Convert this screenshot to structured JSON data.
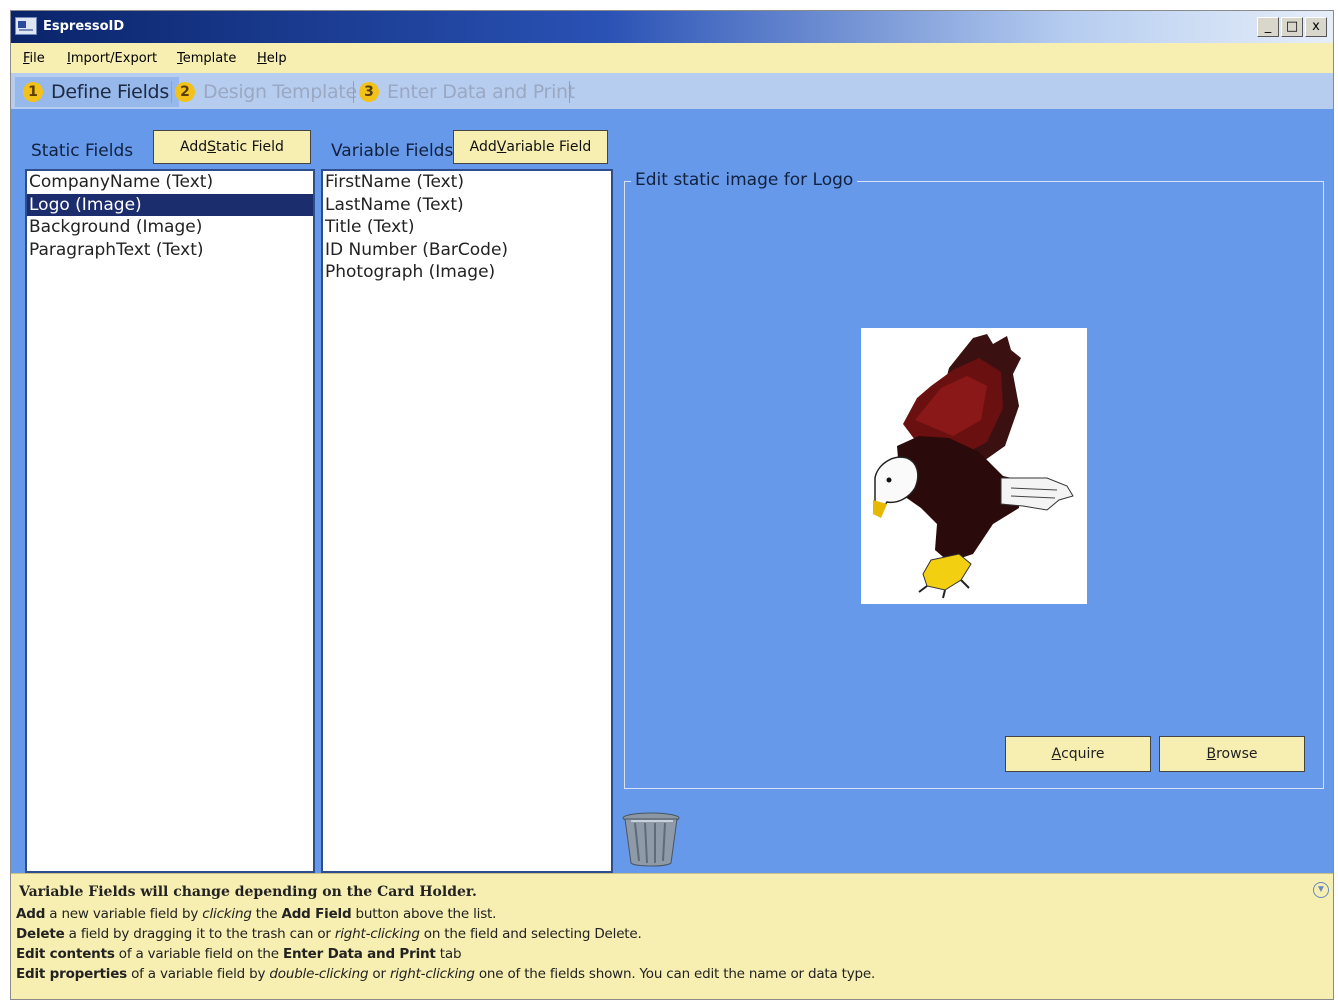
{
  "window": {
    "title": "EspressoID",
    "minimize": "_",
    "maximize": "□",
    "close": "x"
  },
  "menu": {
    "items": [
      {
        "accel": "F",
        "rest": "ile"
      },
      {
        "accel": "I",
        "rest": "mport/Export"
      },
      {
        "accel": "T",
        "rest": "emplate"
      },
      {
        "accel": "H",
        "rest": "elp"
      }
    ]
  },
  "tabs": [
    {
      "number": "1",
      "label": "Define Fields",
      "active": true
    },
    {
      "number": "2",
      "label": "Design Template",
      "active": false
    },
    {
      "number": "3",
      "label": "Enter Data and Print",
      "active": false
    }
  ],
  "static_fields": {
    "heading": "Static Fields",
    "add_button": {
      "pre": "Add ",
      "accel": "S",
      "post": "tatic Field"
    },
    "items": [
      "CompanyName (Text)",
      "Logo (Image)",
      "Background (Image)",
      "ParagraphText (Text)"
    ],
    "selected_index": 1
  },
  "variable_fields": {
    "heading": "Variable Fields",
    "add_button": {
      "pre": "Add ",
      "accel": "V",
      "post": "ariable Field"
    },
    "items": [
      "FirstName (Text)",
      "LastName (Text)",
      "Title (Text)",
      "ID Number (BarCode)",
      "Photograph (Image)"
    ]
  },
  "editor": {
    "legend": "Edit static image for Logo",
    "image_icon": "eagle-logo-image",
    "acquire": {
      "accel": "A",
      "rest": "cquire"
    },
    "browse": {
      "accel": "B",
      "rest": "rowse"
    }
  },
  "trash_icon": "trash-can-icon",
  "help": {
    "heading": "Variable Fields will change depending on the Card Holder.",
    "lines": {
      "add": {
        "b1": "Add",
        "t1": " a new variable field by ",
        "i1": "clicking",
        "t2": " the ",
        "b2": "Add Field",
        "t3": " button above the list."
      },
      "delete": {
        "b1": "Delete",
        "t1": " a field by dragging it to the trash can or ",
        "i1": "right-clicking",
        "t2": " on the field and selecting Delete."
      },
      "edit_contents": {
        "b1": "Edit contents",
        "t1": " of a variable field on the ",
        "b2": "Enter Data and Print",
        "t2": " tab"
      },
      "edit_properties": {
        "b1": "Edit properties",
        "t1": " of a variable field by ",
        "i1": "double-clicking",
        "t2": " or ",
        "i2": "right-clicking",
        "t3": " one of the fields shown.  You can edit the name or data type."
      }
    }
  },
  "colors": {
    "workspace": "#6699ea",
    "panel_yellow": "#f7efb1",
    "selection": "#1c2d6d",
    "tab_badge": "#f3c21a"
  }
}
